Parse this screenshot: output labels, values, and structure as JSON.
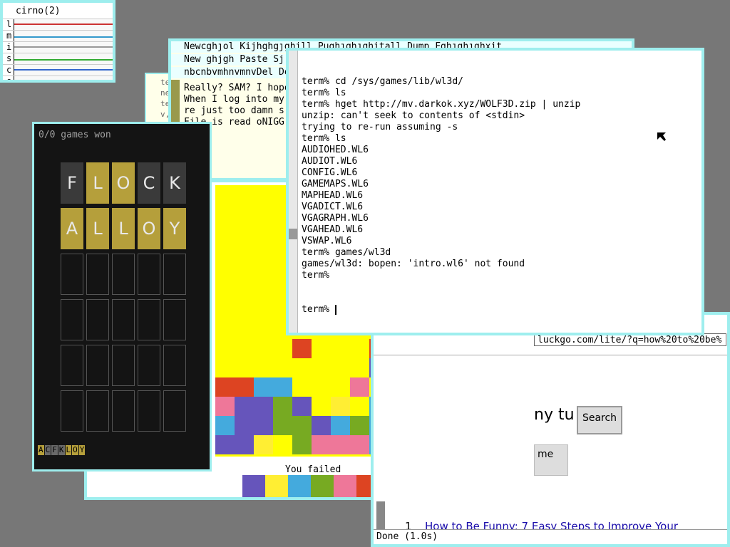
{
  "stats": {
    "title": "cirno(2)",
    "rows": [
      {
        "label": "l",
        "color": "#cc3333"
      },
      {
        "label": "m",
        "color": "#3399cc"
      },
      {
        "label": "i",
        "color": "#999999"
      },
      {
        "label": "s",
        "color": "#33aa33"
      },
      {
        "label": "c",
        "color": "#3366cc"
      },
      {
        "label": "e",
        "color": "#aaaaaa"
      }
    ]
  },
  "acme": {
    "tag1": "Newcghȷol Kijhghgȷghill Pughȷghȷghitall Dump Fghȷghȷghxit",
    "tag2": "New ghjgh Paste Sj",
    "tag3": "nbcnbvmhnvmnvDel De",
    "body": [
      "Really? SAM? I hope",
      "When I log into my",
      "re just too damn s",
      "File is read oNIGG"
    ]
  },
  "partial": {
    "lines": [
      "te",
      "ne",
      "te",
      "v,",
      "I"
    ]
  },
  "wordle": {
    "games_won": "0/0 games won",
    "rows": [
      [
        {
          "l": "F",
          "s": "gray"
        },
        {
          "l": "L",
          "s": "yellow"
        },
        {
          "l": "O",
          "s": "yellow"
        },
        {
          "l": "C",
          "s": "gray"
        },
        {
          "l": "K",
          "s": "gray"
        }
      ],
      [
        {
          "l": "A",
          "s": "yellow"
        },
        {
          "l": "L",
          "s": "yellow"
        },
        {
          "l": "L",
          "s": "yellow"
        },
        {
          "l": "O",
          "s": "yellow"
        },
        {
          "l": "Y",
          "s": "yellow"
        }
      ]
    ],
    "keys": [
      {
        "k": "A",
        "c": "#b59f3b"
      },
      {
        "k": "C",
        "c": "#6a6a6a"
      },
      {
        "k": "F",
        "c": "#6a6a6a"
      },
      {
        "k": "K",
        "c": "#6a6a6a"
      },
      {
        "k": "L",
        "c": "#b59f3b"
      },
      {
        "k": "O",
        "c": "#b59f3b"
      },
      {
        "k": "Y",
        "c": "#b59f3b"
      }
    ]
  },
  "tetris": {
    "failed_text": "You failed",
    "palette": [
      "#6655bb",
      "#ffee33",
      "#44aadd",
      "#77aa22",
      "#ee7799",
      "#dd4422"
    ]
  },
  "browser": {
    "url": "luckgo.com/lite/?q=how%20to%20be%",
    "query_fragment": "ny tu",
    "search_label": "Search",
    "home_label": "me",
    "result_num": "1",
    "result_text": "How to Be Funny: 7 Easy Steps to Improve Your",
    "status": "Done (1.0s)"
  },
  "terminal": {
    "lines": [
      "term% cd /sys/games/lib/wl3d/",
      "term% ls",
      "term% hget http://mv.darkok.xyz/WOLF3D.zip | unzip",
      "unzip: can't seek to contents of <stdin>",
      "trying to re-run assuming -s",
      "term% ls",
      "AUDIOHED.WL6",
      "AUDIOT.WL6",
      "CONFIG.WL6",
      "GAMEMAPS.WL6",
      "MAPHEAD.WL6",
      "VGADICT.WL6",
      "VGAGRAPH.WL6",
      "VGAHEAD.WL6",
      "VSWAP.WL6",
      "term% games/wl3d",
      "games/wl3d: bopen: 'intro.wl6' not found",
      "term%"
    ],
    "prompt": "term% "
  }
}
